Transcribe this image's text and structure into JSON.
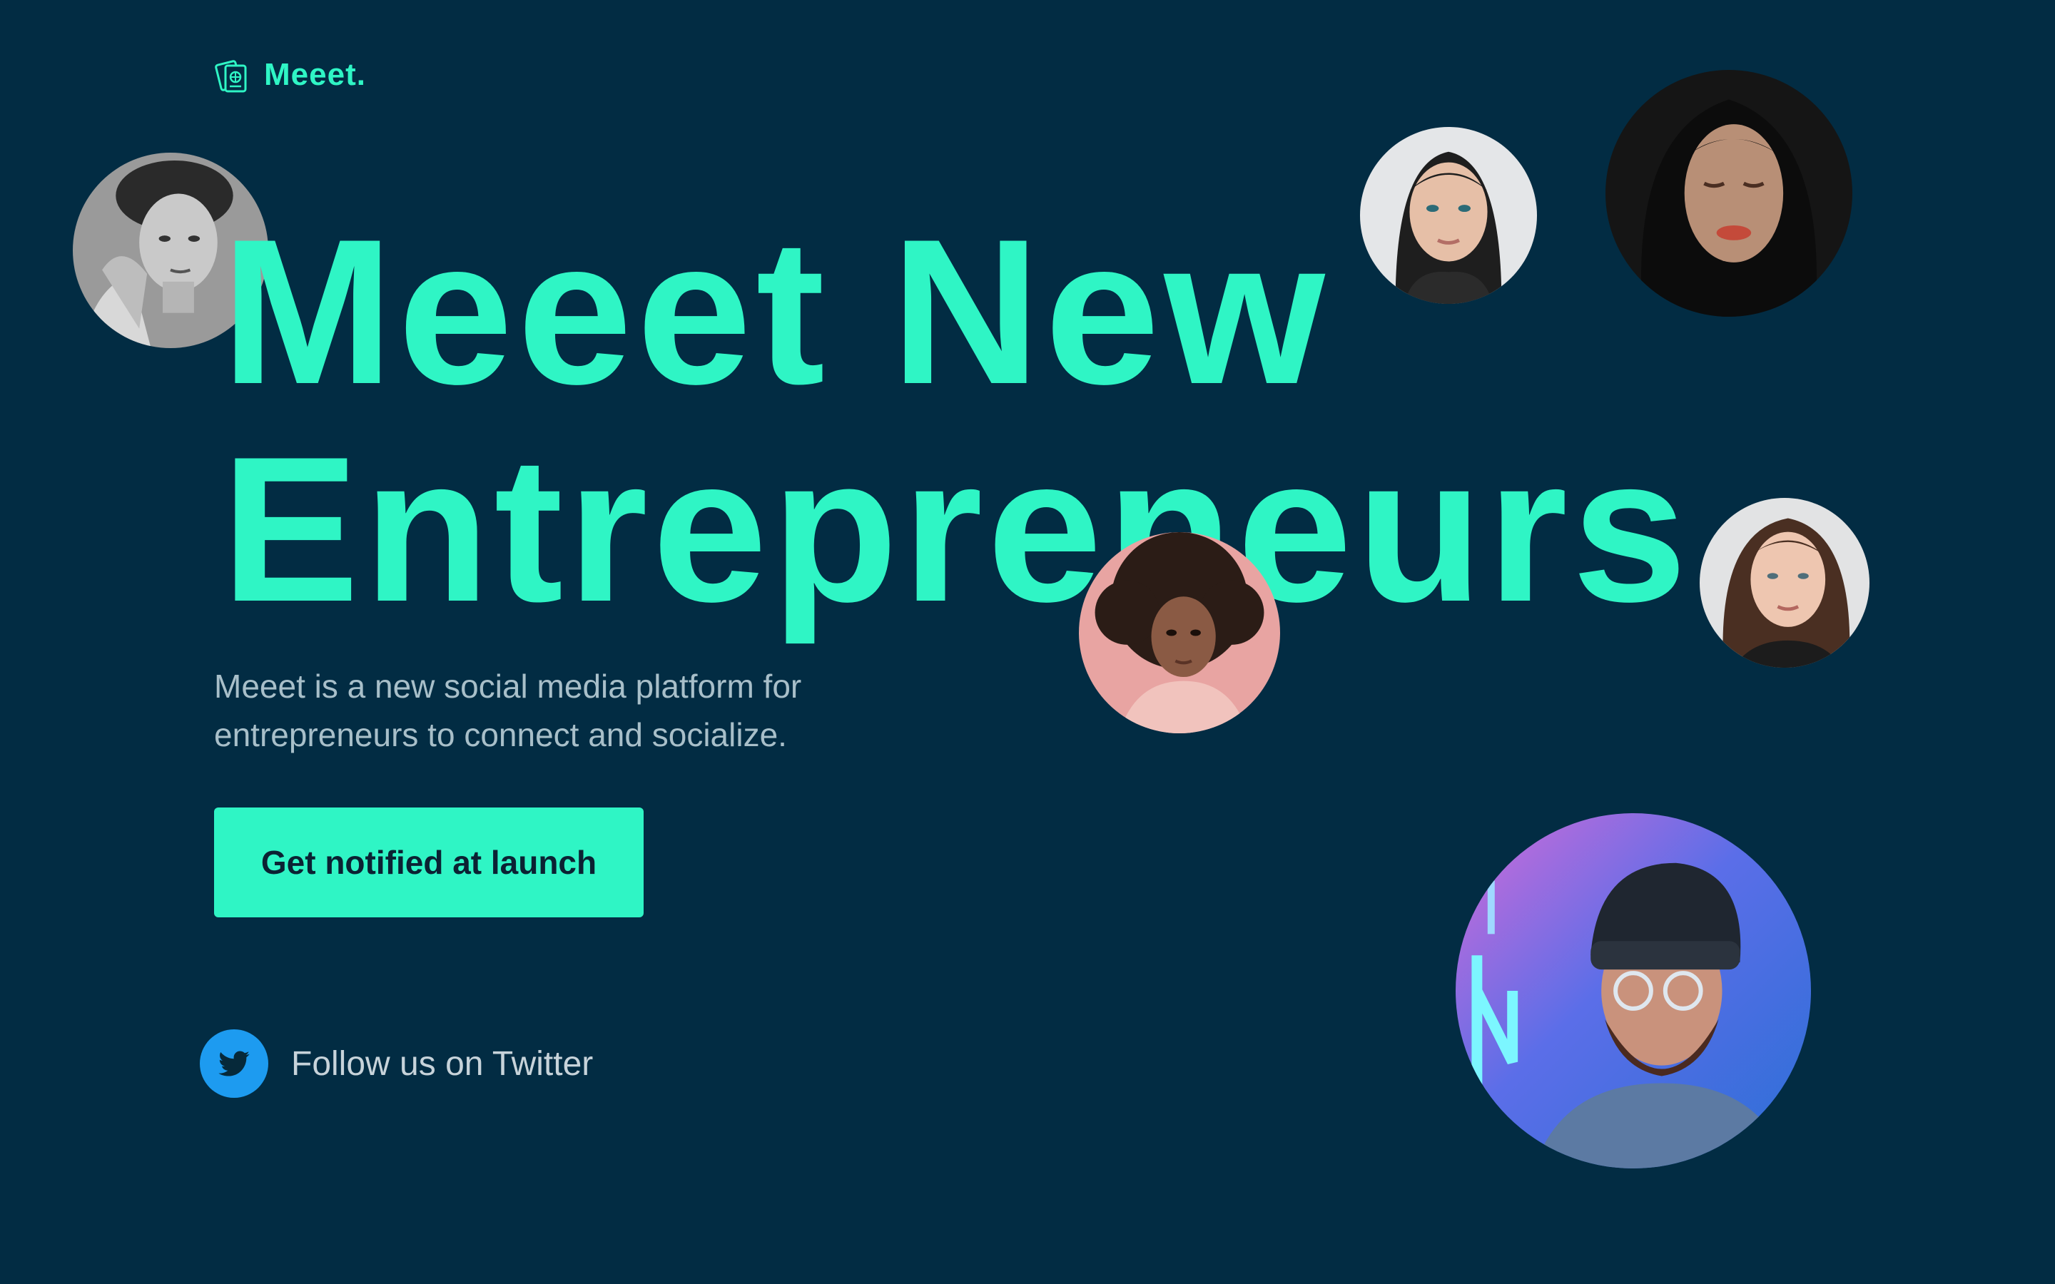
{
  "brand": {
    "name": "Meeet.",
    "icon": "passport-logo-icon",
    "color": "#2ff5c5"
  },
  "hero": {
    "title_line1": "Meeet New",
    "title_line2": "Entrepreneurs",
    "subtitle": "Meeet is a new social media platform for entrepreneurs to connect and socialize.",
    "cta_label": "Get notified at launch"
  },
  "social": {
    "twitter_label": "Follow us on Twitter",
    "twitter_icon": "twitter-bird-icon",
    "twitter_color": "#1d9bf0"
  },
  "theme": {
    "background": "#022c43",
    "accent": "#2ff5c5",
    "muted_text": "#a8bfc9"
  },
  "avatars": [
    {
      "name": "avatar-man-bw"
    },
    {
      "name": "avatar-woman-dark-hair"
    },
    {
      "name": "avatar-woman-closed-eyes"
    },
    {
      "name": "avatar-woman-curly-hair"
    },
    {
      "name": "avatar-woman-brown-hair"
    },
    {
      "name": "avatar-man-beanie-neon"
    }
  ]
}
